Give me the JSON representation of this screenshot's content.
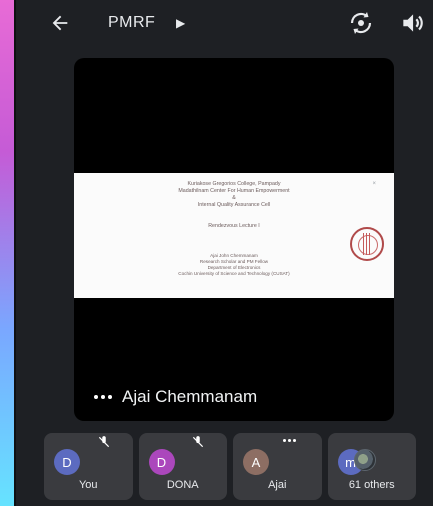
{
  "header": {
    "title": "PMRF",
    "back_icon": "arrow-left-icon",
    "switch_camera_icon": "switch-camera-icon",
    "speaker_icon": "speaker-icon"
  },
  "stage": {
    "presenter_name": "Ajai Chemmanam",
    "slide_lines": [
      "Kuriakose Gregorios College, Pampady",
      "Madathilnam Center For Human Empowerment",
      "&",
      "Internal Quality Assurance Cell",
      "Rendezvous Lecture I",
      "Ajai John Chemmanam",
      "Research Scholar and PM Fellow",
      "Department of Electronics",
      "Cochin University of Science and Technology (CUSAT)"
    ]
  },
  "participants": [
    {
      "initial": "D",
      "label": "You",
      "color": "#5c6bc0",
      "muted": true
    },
    {
      "initial": "D",
      "label": "DONA",
      "color": "#ab47bc",
      "muted": true
    },
    {
      "initial": "A",
      "label": "Ajai",
      "color": "#8d6e63",
      "muted": false
    },
    {
      "initial": "m",
      "label": "61 others",
      "color": "#5c6bc0",
      "muted": false
    }
  ]
}
